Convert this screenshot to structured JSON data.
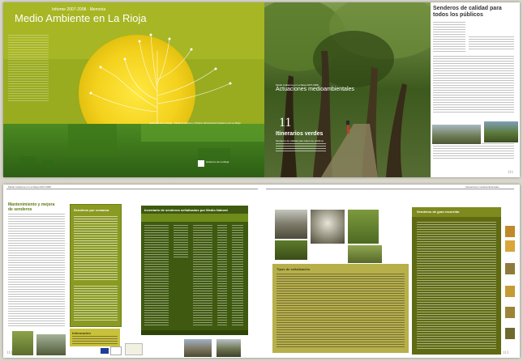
{
  "spread1": {
    "left": {
      "top_label": "Informe 2007-2008 · Memoria",
      "title": "Medio Ambiente en La Rioja",
      "tagline": "Gobierno de La Rioja · Medio Ambiente y Política Territorial del Gobierno de La Rioja",
      "logo_text": "Gobierno de La Rioja"
    },
    "right": {
      "section_small": "Medio Ambiente en La Rioja 2007-2008",
      "section_title": "Actuaciones medioambientales",
      "chapter_number": "11",
      "chapter_title": "Itinerarios verdes",
      "chapter_sub": "Senderos de calidad para todos los públicos",
      "feature_title": "Senderos de calidad para todos los públicos",
      "page_number": "111"
    }
  },
  "spread2": {
    "left": {
      "page_number": "112",
      "heading": "Mantenimiento y mejora de senderos",
      "green_box_title": "Senderos por comarca",
      "table_title": "Inventario de senderos señalizados por Medio Natural",
      "yellow_box_title": "Información"
    },
    "right": {
      "page_number": "113",
      "side_box_title": "Senderos de gran recorrido",
      "khaki_box_title": "Tipos de señalización"
    }
  }
}
